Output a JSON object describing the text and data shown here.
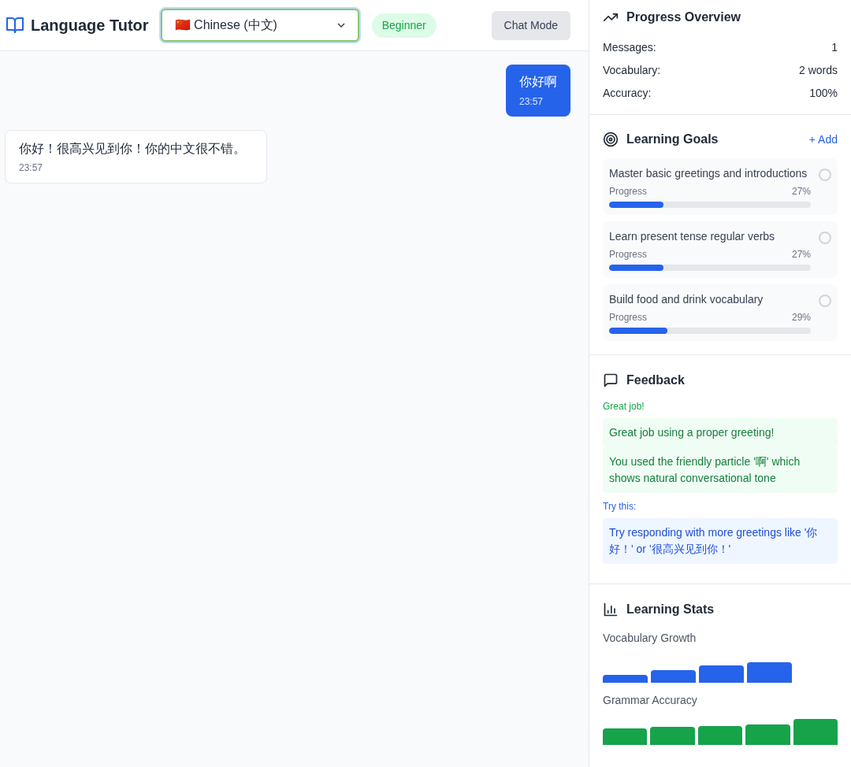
{
  "header": {
    "title": "Language Tutor",
    "language": "🇨🇳 Chinese (中文)",
    "level_badge": "Beginner",
    "mode_button": "Chat Mode"
  },
  "messages": [
    {
      "kind": "user",
      "text": "你好啊",
      "time": "23:57"
    },
    {
      "kind": "tutor",
      "text": "你好！很高兴见到你！你的中文很不错。",
      "time": "23:57"
    }
  ],
  "progress_overview": {
    "title": "Progress Overview",
    "stats": [
      {
        "label": "Messages:",
        "value": "1"
      },
      {
        "label": "Vocabulary:",
        "value": "2 words"
      },
      {
        "label": "Accuracy:",
        "value": "100%"
      }
    ]
  },
  "learning_goals": {
    "title": "Learning Goals",
    "add_button": "+ Add",
    "goals": [
      {
        "text": "Master basic greetings and introductions",
        "progress_label": "Progress",
        "percent": "27%",
        "level": 0.27,
        "checked": false
      },
      {
        "text": "Learn present tense regular verbs",
        "progress_label": "Progress",
        "percent": "27%",
        "level": 0.27,
        "checked": false
      },
      {
        "text": "Build food and drink vocabulary",
        "progress_label": "Progress",
        "percent": "29%",
        "level": 0.29,
        "checked": false
      }
    ]
  },
  "feedback": {
    "title": "Feedback",
    "groups": [
      {
        "kind": "praise",
        "heading": "Great job!",
        "items": [
          "Great job using a proper greeting!",
          "You used the friendly particle '啊' which shows natural conversational tone"
        ]
      },
      {
        "kind": "suggestion",
        "heading": "Try this:",
        "items": [
          "Try responding with more greetings like '你好！' or '很高兴见到你！'"
        ]
      }
    ]
  },
  "learning_stats": {
    "title": "Learning Stats",
    "charts": [
      {
        "kind": "vocabulary",
        "label": "Vocabulary Growth"
      },
      {
        "kind": "grammar",
        "label": "Grammar Accuracy"
      }
    ]
  }
}
